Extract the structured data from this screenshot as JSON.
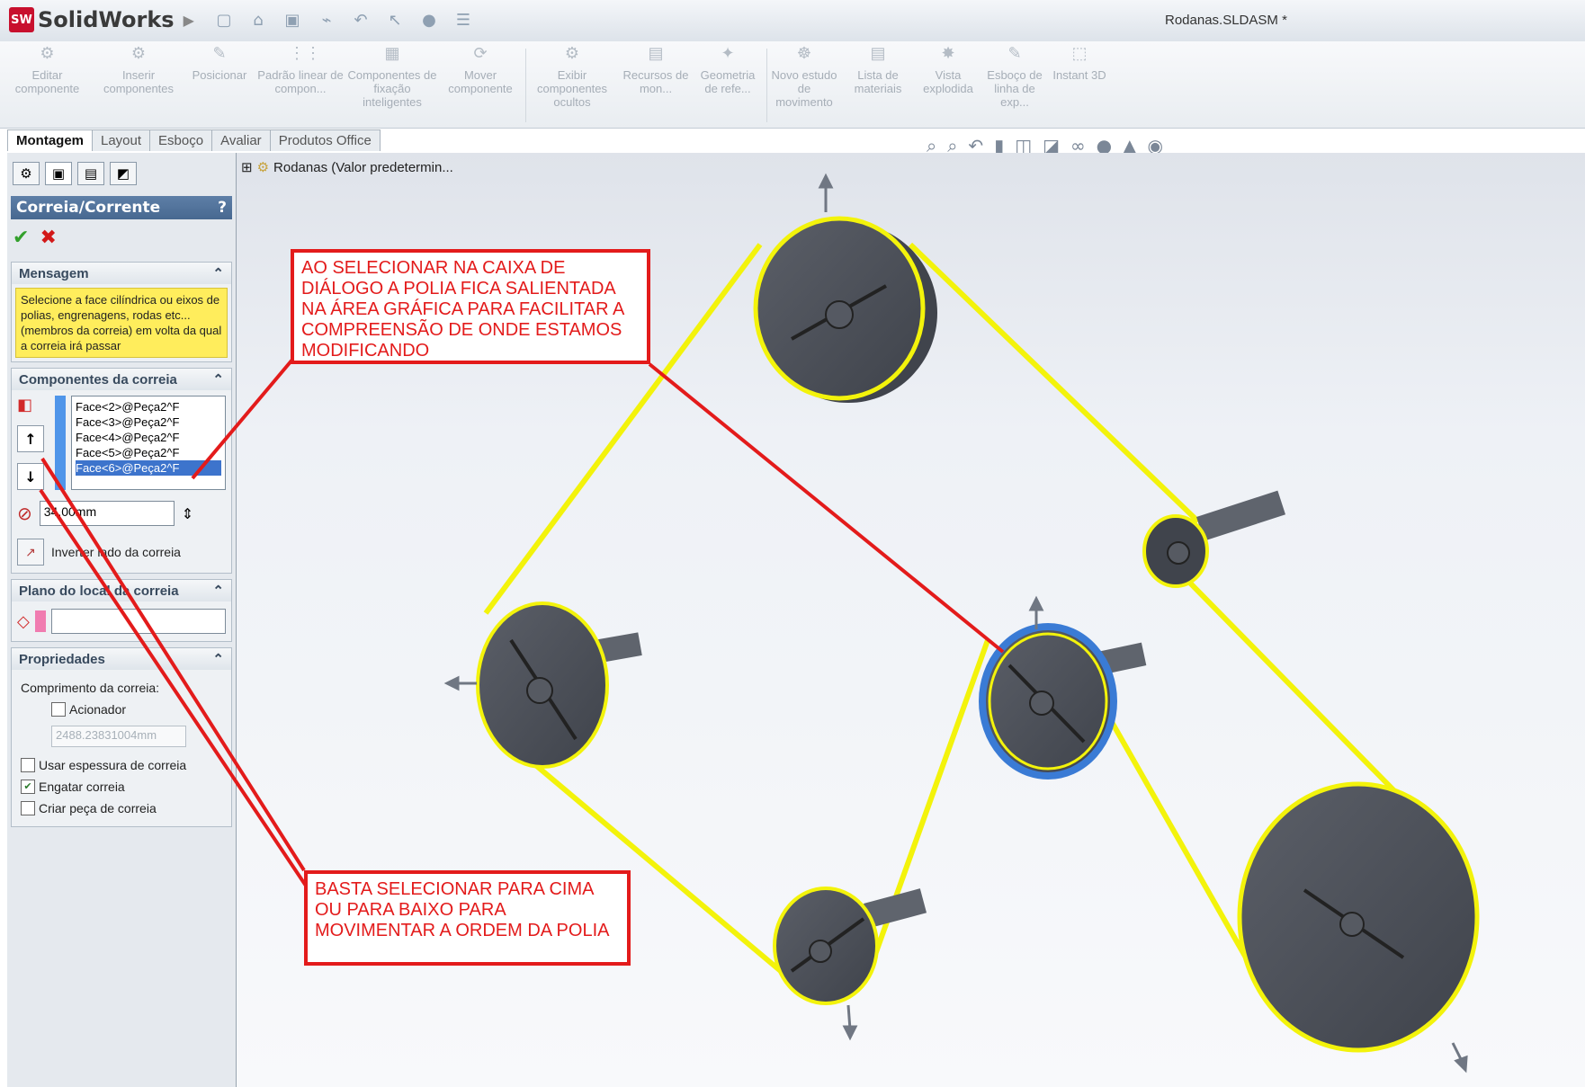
{
  "app": {
    "logo_badge": "SW",
    "logo": "SolidWorks",
    "document_title": "Rodanas.SLDASM *"
  },
  "ribbon": [
    "Editar componente",
    "Inserir componentes",
    "Posicionar",
    "Padrão linear de compon...",
    "Componentes de fixação inteligentes",
    "Mover componente",
    "Exibir componentes ocultos",
    "Recursos de mon...",
    "Geometria de refe...",
    "Novo estudo de movimento",
    "Lista de materiais",
    "Vista explodida",
    "Esboço de linha de exp...",
    "Instant 3D"
  ],
  "tabs": [
    "Montagem",
    "Layout",
    "Esboço",
    "Avaliar",
    "Produtos Office"
  ],
  "tree": {
    "root": "Rodanas (Valor predetermin..."
  },
  "panel": {
    "title": "Correia/Corrente",
    "help": "?",
    "sections": {
      "message": "Mensagem",
      "components": "Componentes da correia",
      "plane": "Plano do local da correia",
      "properties": "Propriedades"
    },
    "message_text": "Selecione a face cilíndrica ou eixos de polias, engrenagens, rodas etc... (membros da correia) em volta da qual a correia irá passar",
    "faces": [
      "Face<2>@Peça2^F",
      "Face<3>@Peça2^F",
      "Face<4>@Peça2^F",
      "Face<5>@Peça2^F",
      "Face<6>@Peça2^F"
    ],
    "diameter": "34.00mm",
    "reverse_label": "Inverter lado da correia",
    "belt_length_label": "Comprimento da correia:",
    "driver": "Acionador",
    "length_value": "2488.23831004mm",
    "use_thickness": "Usar espessura de correia",
    "engage": "Engatar correia",
    "create_part": "Criar peça de correia"
  },
  "annotations": {
    "top": "AO SELECIONAR NA CAIXA DE DIÁLOGO A POLIA FICA SALIENTADA NA ÁREA GRÁFICA PARA FACILITAR A COMPREENSÃO DE ONDE ESTAMOS MODIFICANDO",
    "bottom": "BASTA SELECIONAR PARA CIMA OU PARA BAIXO PARA MOVIMENTAR A ORDEM DA POLIA"
  },
  "colors": {
    "belt": "#f3f30b",
    "callout": "#e31b1b",
    "pulley": "#4b4f58"
  }
}
